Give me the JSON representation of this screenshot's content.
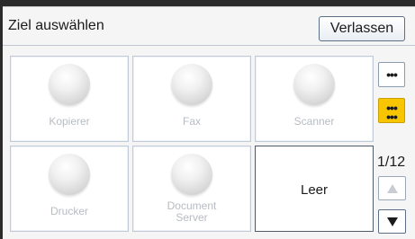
{
  "header": {
    "title": "Ziel auswählen",
    "exit_label": "Verlassen"
  },
  "tiles": [
    {
      "label": "Kopierer",
      "icon": "disabled-orb-icon",
      "enabled": false
    },
    {
      "label": "Fax",
      "icon": "disabled-orb-icon",
      "enabled": false
    },
    {
      "label": "Scanner",
      "icon": "disabled-orb-icon",
      "enabled": false
    },
    {
      "label": "Drucker",
      "icon": "disabled-orb-icon",
      "enabled": false
    },
    {
      "label_line1": "Document",
      "label_line2": "Server",
      "icon": "disabled-orb-icon",
      "enabled": false
    },
    {
      "label": "Leer",
      "enabled": true
    }
  ],
  "side": {
    "list_view_icon": "three-dots-icon",
    "grid_view_icon": "grid-dots-icon",
    "page_indicator": "1/12",
    "up_icon": "arrow-up-icon",
    "down_icon": "arrow-down-icon"
  },
  "colors": {
    "background": "#f5f5f5",
    "accent": "#f7c600",
    "disabled_text": "#b7bcc3"
  }
}
